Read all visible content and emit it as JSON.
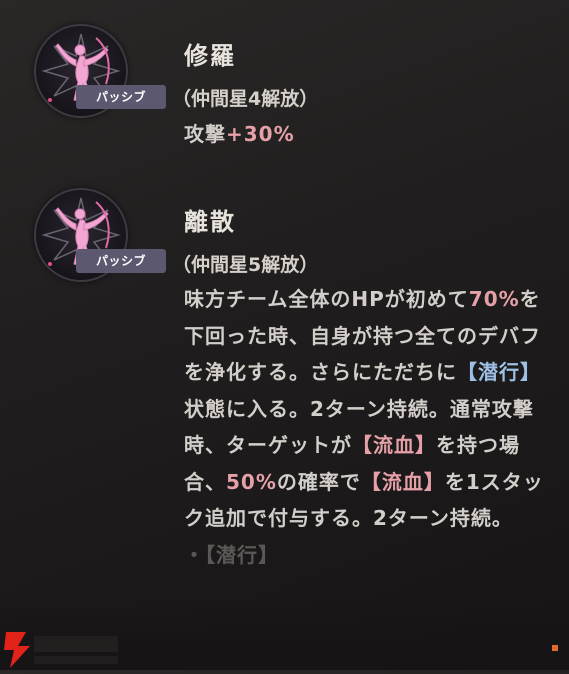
{
  "skills": [
    {
      "name": "修羅",
      "condition": "（仲間星4解放）",
      "badge": "パッシブ",
      "effect": {
        "stat": "攻撃",
        "value": "+30%"
      }
    },
    {
      "name": "離散",
      "condition": "（仲間星5解放）",
      "badge": "パッシブ",
      "desc": {
        "p1": "味方チーム全体のHPが初めて",
        "hp_threshold": "70%",
        "p2": "を下回った時、自身が持つ全てのデバフを浄化する。さらにただちに",
        "status_stealth": "【潜行】",
        "p3": "状態に入る。2ターン持続。通常攻撃時、ターゲットが",
        "status_bleed": "【流血】",
        "p4": "を持つ場合、",
        "chance": "50%",
        "p5": "の確率で",
        "status_bleed_2": "【流血】",
        "p6": "を1スタック追加で付与する。2ターン持続。",
        "cut_line": "・【潜行】"
      }
    }
  ],
  "colors": {
    "highlight_number": "#e5a0a8",
    "highlight_status": "#9ebfe6",
    "accent": "#e26a2c"
  }
}
